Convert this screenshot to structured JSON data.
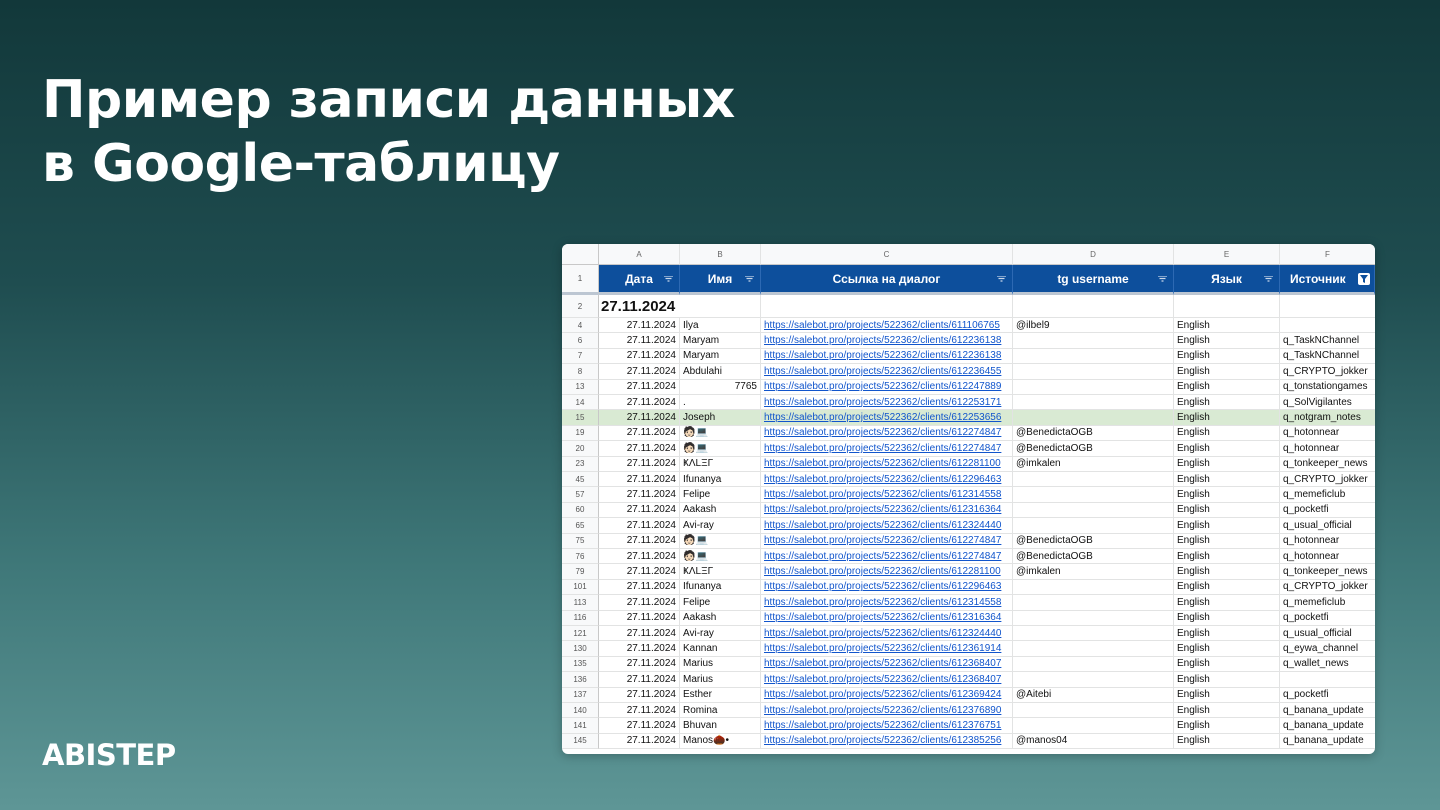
{
  "heading": {
    "line1": "Пример записи данных",
    "line2": "в Google-таблицу"
  },
  "brand": "ABISTEP",
  "sheet": {
    "column_letters": [
      "A",
      "B",
      "C",
      "D",
      "E",
      "F"
    ],
    "headers": [
      "Дата",
      "Имя",
      "Ссылка на диалог",
      "tg username",
      "Язык",
      "Источник"
    ],
    "header_row_num": "1",
    "date_group": {
      "row_num": "2",
      "label": "27.11.2024"
    },
    "colors": {
      "header_bg": "#0d4f9c",
      "link": "#1155cc",
      "highlight": "#d9ead3"
    },
    "rows": [
      {
        "num": "4",
        "date": "27.11.2024",
        "name": "Ilya",
        "link": "https://salebot.pro/projects/522362/clients/611106765",
        "username": "@ilbel9",
        "lang": "English",
        "source": ""
      },
      {
        "num": "6",
        "date": "27.11.2024",
        "name": "Maryam",
        "link": "https://salebot.pro/projects/522362/clients/612236138",
        "username": "",
        "lang": "English",
        "source": "q_TaskNChannel"
      },
      {
        "num": "7",
        "date": "27.11.2024",
        "name": "Maryam",
        "link": "https://salebot.pro/projects/522362/clients/612236138",
        "username": "",
        "lang": "English",
        "source": "q_TaskNChannel"
      },
      {
        "num": "8",
        "date": "27.11.2024",
        "name": "Abdulahi",
        "link": "https://salebot.pro/projects/522362/clients/612236455",
        "username": "",
        "lang": "English",
        "source": "q_CRYPTO_jokker"
      },
      {
        "num": "13",
        "date": "27.11.2024",
        "name": "7765",
        "link": "https://salebot.pro/projects/522362/clients/612247889",
        "username": "",
        "lang": "English",
        "source": "q_tonstationgames",
        "name_numeric": true
      },
      {
        "num": "14",
        "date": "27.11.2024",
        "name": ".",
        "link": "https://salebot.pro/projects/522362/clients/612253171",
        "username": "",
        "lang": "English",
        "source": "q_SolVigilantes"
      },
      {
        "num": "15",
        "date": "27.11.2024",
        "name": "Joseph",
        "link": "https://salebot.pro/projects/522362/clients/612253656",
        "username": "",
        "lang": "English",
        "source": "q_notgram_notes",
        "highlight": true
      },
      {
        "num": "19",
        "date": "27.11.2024",
        "name": "🧑🏻💻",
        "link": "https://salebot.pro/projects/522362/clients/612274847",
        "username": "@BenedictaOGB",
        "lang": "English",
        "source": "q_hotonnear"
      },
      {
        "num": "20",
        "date": "27.11.2024",
        "name": "🧑🏻💻",
        "link": "https://salebot.pro/projects/522362/clients/612274847",
        "username": "@BenedictaOGB",
        "lang": "English",
        "source": "q_hotonnear"
      },
      {
        "num": "23",
        "date": "27.11.2024",
        "name": "ҜΛLΞΓ",
        "link": "https://salebot.pro/projects/522362/clients/612281100",
        "username": "@imkalen",
        "lang": "English",
        "source": "q_tonkeeper_news"
      },
      {
        "num": "45",
        "date": "27.11.2024",
        "name": "Ifunanya",
        "link": "https://salebot.pro/projects/522362/clients/612296463",
        "username": "",
        "lang": "English",
        "source": "q_CRYPTO_jokker"
      },
      {
        "num": "57",
        "date": "27.11.2024",
        "name": "Felipe",
        "link": "https://salebot.pro/projects/522362/clients/612314558",
        "username": "",
        "lang": "English",
        "source": "q_memeficlub"
      },
      {
        "num": "60",
        "date": "27.11.2024",
        "name": "Aakash",
        "link": "https://salebot.pro/projects/522362/clients/612316364",
        "username": "",
        "lang": "English",
        "source": "q_pocketfi"
      },
      {
        "num": "65",
        "date": "27.11.2024",
        "name": "Avi-ray",
        "link": "https://salebot.pro/projects/522362/clients/612324440",
        "username": "",
        "lang": "English",
        "source": "q_usual_official"
      },
      {
        "num": "75",
        "date": "27.11.2024",
        "name": "🧑🏻💻",
        "link": "https://salebot.pro/projects/522362/clients/612274847",
        "username": "@BenedictaOGB",
        "lang": "English",
        "source": "q_hotonnear"
      },
      {
        "num": "76",
        "date": "27.11.2024",
        "name": "🧑🏻💻",
        "link": "https://salebot.pro/projects/522362/clients/612274847",
        "username": "@BenedictaOGB",
        "lang": "English",
        "source": "q_hotonnear"
      },
      {
        "num": "79",
        "date": "27.11.2024",
        "name": "ҜΛLΞΓ",
        "link": "https://salebot.pro/projects/522362/clients/612281100",
        "username": "@imkalen",
        "lang": "English",
        "source": "q_tonkeeper_news"
      },
      {
        "num": "101",
        "date": "27.11.2024",
        "name": "Ifunanya",
        "link": "https://salebot.pro/projects/522362/clients/612296463",
        "username": "",
        "lang": "English",
        "source": "q_CRYPTO_jokker"
      },
      {
        "num": "113",
        "date": "27.11.2024",
        "name": "Felipe",
        "link": "https://salebot.pro/projects/522362/clients/612314558",
        "username": "",
        "lang": "English",
        "source": "q_memeficlub"
      },
      {
        "num": "116",
        "date": "27.11.2024",
        "name": "Aakash",
        "link": "https://salebot.pro/projects/522362/clients/612316364",
        "username": "",
        "lang": "English",
        "source": "q_pocketfi"
      },
      {
        "num": "121",
        "date": "27.11.2024",
        "name": "Avi-ray",
        "link": "https://salebot.pro/projects/522362/clients/612324440",
        "username": "",
        "lang": "English",
        "source": "q_usual_official"
      },
      {
        "num": "130",
        "date": "27.11.2024",
        "name": "Kannan",
        "link": "https://salebot.pro/projects/522362/clients/612361914",
        "username": "",
        "lang": "English",
        "source": "q_eywa_channel"
      },
      {
        "num": "135",
        "date": "27.11.2024",
        "name": "Marius",
        "link": "https://salebot.pro/projects/522362/clients/612368407",
        "username": "",
        "lang": "English",
        "source": "q_wallet_news"
      },
      {
        "num": "136",
        "date": "27.11.2024",
        "name": "Marius",
        "link": "https://salebot.pro/projects/522362/clients/612368407",
        "username": "",
        "lang": "English",
        "source": ""
      },
      {
        "num": "137",
        "date": "27.11.2024",
        "name": "Esther",
        "link": "https://salebot.pro/projects/522362/clients/612369424",
        "username": "@Aitebi",
        "lang": "English",
        "source": "q_pocketfi"
      },
      {
        "num": "140",
        "date": "27.11.2024",
        "name": "Romina",
        "link": "https://salebot.pro/projects/522362/clients/612376890",
        "username": "",
        "lang": "English",
        "source": "q_banana_update"
      },
      {
        "num": "141",
        "date": "27.11.2024",
        "name": "Bhuvan",
        "link": "https://salebot.pro/projects/522362/clients/612376751",
        "username": "",
        "lang": "English",
        "source": "q_banana_update"
      },
      {
        "num": "145",
        "date": "27.11.2024",
        "name": "Manos🌰•",
        "link": "https://salebot.pro/projects/522362/clients/612385256",
        "username": "@manos04",
        "lang": "English",
        "source": "q_banana_update"
      }
    ]
  }
}
